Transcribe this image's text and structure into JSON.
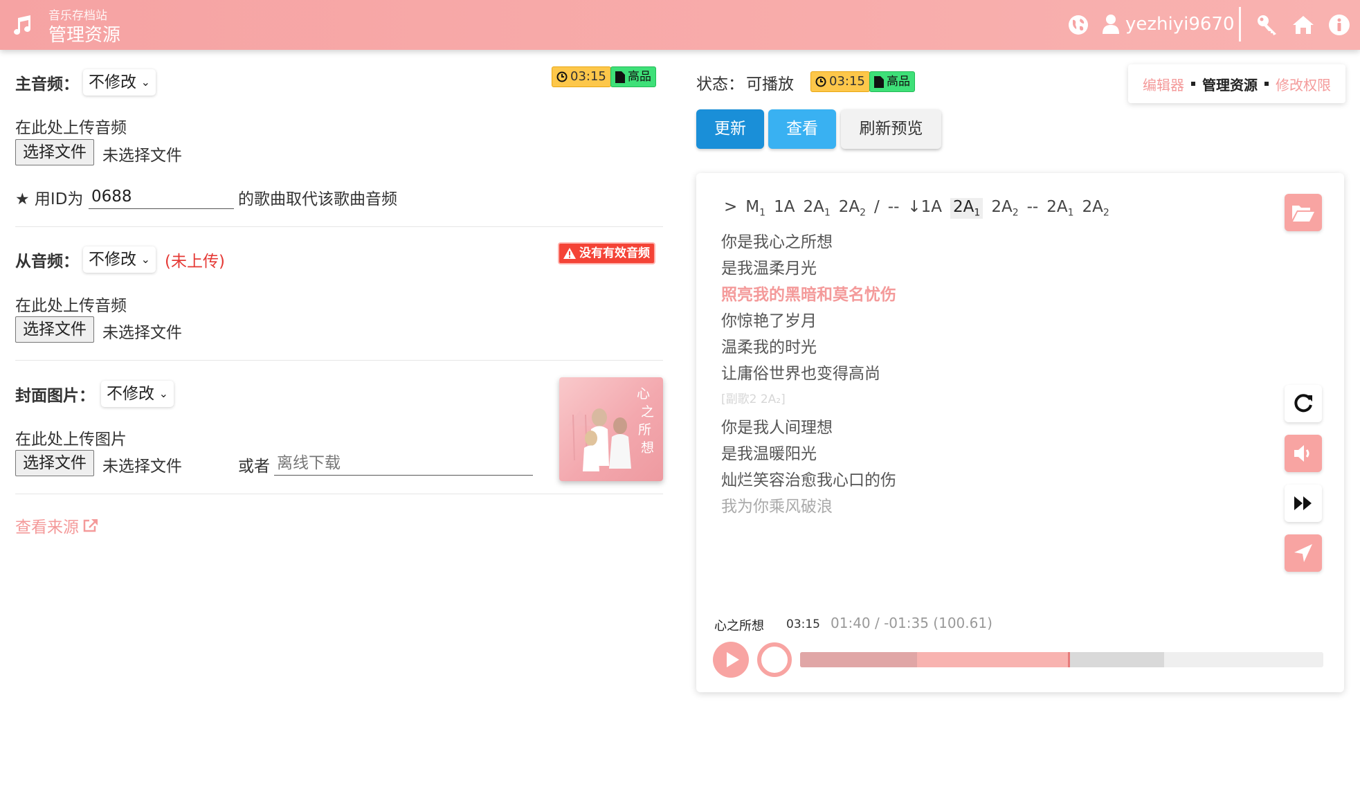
{
  "header": {
    "site_sub": "音乐存档站",
    "site_title": "管理资源",
    "username": "yezhiyi9670",
    "icons": [
      "music-icon",
      "globe-icon",
      "user-icon",
      "key-icon",
      "home-icon",
      "info-icon"
    ]
  },
  "main_audio": {
    "label": "主音频：",
    "select_value": "不修改",
    "duration_badge": "03:15",
    "quality_badge": "高品",
    "upload_label": "在此处上传音频",
    "file_button": "选择文件",
    "file_status": "未选择文件",
    "replace_prefix": "★ 用ID为",
    "replace_id": "0688",
    "replace_suffix": "的歌曲取代该歌曲音频"
  },
  "sub_audio": {
    "label": "从音频：",
    "select_value": "不修改",
    "status": "(未上传)",
    "warning_badge": "没有有效音频",
    "upload_label": "在此处上传音频",
    "file_button": "选择文件",
    "file_status": "未选择文件"
  },
  "cover": {
    "label": "封面图片：",
    "select_value": "不修改",
    "upload_label": "在此处上传图片",
    "file_button": "选择文件",
    "file_status": "未选择文件",
    "or_label": "或者",
    "download_placeholder": "离线下载",
    "art_text": "心之所想"
  },
  "source_link": "查看来源",
  "right": {
    "status_label": "状态：",
    "status_value": "可播放",
    "duration_badge": "03:15",
    "quality_badge": "高品",
    "breadcrumb": {
      "editor": "编辑器",
      "current": "管理资源",
      "permission": "修改权限"
    },
    "buttons": {
      "update": "更新",
      "view": "查看",
      "refresh": "刷新预览"
    }
  },
  "player": {
    "sequence": [
      {
        "text": ">",
        "sub": ""
      },
      {
        "text": "M",
        "sub": "1"
      },
      {
        "text": "1A",
        "sub": ""
      },
      {
        "text": "2A",
        "sub": "1"
      },
      {
        "text": "2A",
        "sub": "2"
      },
      {
        "text": "/",
        "sub": ""
      },
      {
        "text": "--",
        "sub": ""
      },
      {
        "text": "↓1A",
        "sub": ""
      },
      {
        "text": "2A",
        "sub": "1",
        "highlight": true
      },
      {
        "text": "2A",
        "sub": "2"
      },
      {
        "text": "--",
        "sub": ""
      },
      {
        "text": "2A",
        "sub": "1"
      },
      {
        "text": "2A",
        "sub": "2"
      }
    ],
    "lyrics": [
      {
        "text": "你是我心之所想",
        "state": "normal"
      },
      {
        "text": "是我温柔月光",
        "state": "normal"
      },
      {
        "text": "照亮我的黑暗和莫名忧伤",
        "state": "active"
      },
      {
        "text": "你惊艳了岁月",
        "state": "normal"
      },
      {
        "text": "温柔我的时光",
        "state": "normal"
      },
      {
        "text": "让庸俗世界也变得高尚",
        "state": "normal"
      },
      {
        "text": "[副歌2 2A₂]",
        "state": "marker"
      },
      {
        "text": "你是我人间理想",
        "state": "normal"
      },
      {
        "text": "是我温暖阳光",
        "state": "normal"
      },
      {
        "text": "灿烂笑容治愈我心口的伤",
        "state": "normal"
      },
      {
        "text": "我为你乘风破浪",
        "state": "fade"
      }
    ],
    "song_name": "心之所想",
    "song_duration": "03:15",
    "position_text": "01:40 / -01:35 (100.61)",
    "progress": {
      "played_fraction": 0.512,
      "buffered_fraction": 0.696,
      "loop_fraction": 0.223
    },
    "side_buttons": [
      "folder-open-icon",
      "refresh-icon",
      "volume-icon",
      "fast-forward-icon",
      "locate-icon"
    ]
  },
  "colors": {
    "accent": "#f8a4a2",
    "header_bg": "#f6a3a3",
    "primary_button": "#1a8fd8",
    "info_button": "#39b1f2",
    "warning": "#f44336",
    "duration_badge": "#fdc74a",
    "quality_badge": "#3ee078"
  }
}
